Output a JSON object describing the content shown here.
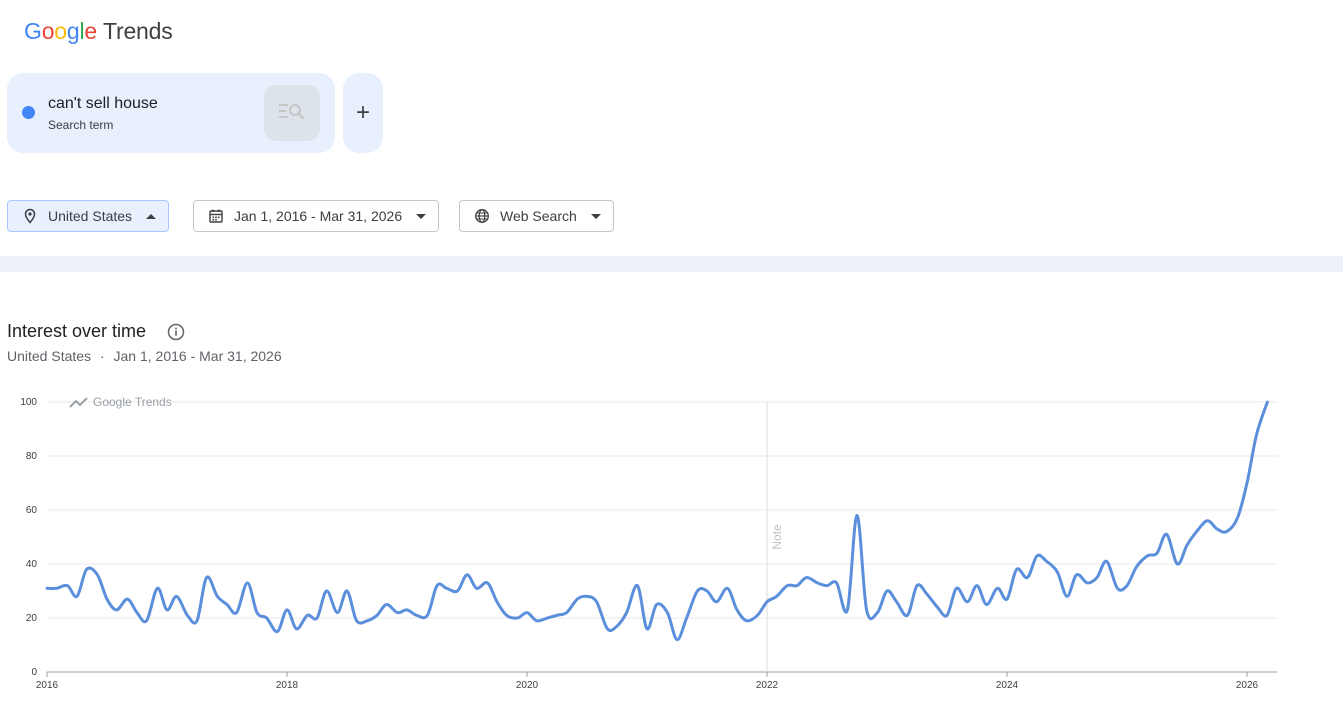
{
  "header": {
    "logo_google": "Google",
    "logo_trends": "Trends"
  },
  "term": {
    "name": "can't sell house",
    "type": "Search term",
    "color": "#4285f4",
    "add_label": "+"
  },
  "filters": {
    "region": "United States",
    "date_range": "Jan 1, 2016 - Mar 31, 2026",
    "property": "Web Search"
  },
  "section": {
    "title": "Interest over time",
    "region": "United States",
    "separator": "·",
    "date_range": "Jan 1, 2016 - Mar 31, 2026"
  },
  "chart_data": {
    "type": "line",
    "watermark": "Google Trends",
    "annotation": {
      "label": "Note",
      "x": 2022.0
    },
    "xlim": [
      2016.0,
      2026.25
    ],
    "ylim": [
      0,
      100
    ],
    "x_ticks": [
      {
        "value": 2016,
        "label": "2016"
      },
      {
        "value": 2018,
        "label": "2018"
      },
      {
        "value": 2020,
        "label": "2020"
      },
      {
        "value": 2022,
        "label": "2022"
      },
      {
        "value": 2024,
        "label": "2024"
      },
      {
        "value": 2026,
        "label": "2026"
      }
    ],
    "y_ticks": [
      0,
      20,
      40,
      60,
      80,
      100
    ],
    "line_color": "#5b8fdc",
    "series": [
      {
        "x": [
          2016.0,
          2016.08,
          2016.17,
          2016.25,
          2016.33,
          2016.42,
          2016.5,
          2016.58,
          2016.67,
          2016.75,
          2016.83,
          2016.92,
          2017.0,
          2017.08,
          2017.17,
          2017.25,
          2017.33,
          2017.42,
          2017.5,
          2017.58,
          2017.67,
          2017.75,
          2017.83,
          2017.92,
          2018.0,
          2018.08,
          2018.17,
          2018.25,
          2018.33,
          2018.42,
          2018.5,
          2018.58,
          2018.67,
          2018.75,
          2018.83,
          2018.92,
          2019.0,
          2019.08,
          2019.17,
          2019.25,
          2019.33,
          2019.42,
          2019.5,
          2019.58,
          2019.67,
          2019.75,
          2019.83,
          2019.92,
          2020.0,
          2020.08,
          2020.17,
          2020.25,
          2020.33,
          2020.42,
          2020.5,
          2020.58,
          2020.67,
          2020.75,
          2020.83,
          2020.92,
          2021.0,
          2021.08,
          2021.17,
          2021.25,
          2021.33,
          2021.42,
          2021.5,
          2021.58,
          2021.67,
          2021.75,
          2021.83,
          2021.92,
          2022.0,
          2022.08,
          2022.17,
          2022.25,
          2022.33,
          2022.42,
          2022.5,
          2022.58,
          2022.67,
          2022.75,
          2022.83,
          2022.92,
          2023.0,
          2023.08,
          2023.17,
          2023.25,
          2023.33,
          2023.42,
          2023.5,
          2023.58,
          2023.67,
          2023.75,
          2023.83,
          2023.92,
          2024.0,
          2024.08,
          2024.17,
          2024.25,
          2024.33,
          2024.42,
          2024.5,
          2024.58,
          2024.67,
          2024.75,
          2024.83,
          2024.92,
          2025.0,
          2025.08,
          2025.17,
          2025.25,
          2025.33,
          2025.42,
          2025.5,
          2025.58,
          2025.67,
          2025.75,
          2025.83,
          2025.92,
          2026.0,
          2026.08,
          2026.17
        ],
        "values": [
          31,
          31,
          32,
          28,
          38,
          36,
          27,
          23,
          27,
          22,
          19,
          31,
          23,
          28,
          21,
          19,
          35,
          28,
          25,
          22,
          33,
          22,
          20,
          15,
          23,
          16,
          21,
          20,
          30,
          22,
          30,
          19,
          19,
          21,
          25,
          22,
          23,
          21,
          21,
          32,
          31,
          30,
          36,
          31,
          33,
          26,
          21,
          20,
          22,
          19,
          20,
          21,
          22,
          27,
          28,
          26,
          16,
          17,
          22,
          32,
          16,
          25,
          22,
          12,
          20,
          30,
          30,
          26,
          31,
          23,
          19,
          21,
          26,
          28,
          32,
          32,
          35,
          33,
          32,
          33,
          23,
          58,
          23,
          22,
          30,
          26,
          21,
          32,
          29,
          24,
          21,
          31,
          26,
          32,
          25,
          31,
          27,
          38,
          35,
          43,
          41,
          37,
          28,
          36,
          33,
          35,
          41,
          31,
          32,
          39,
          43,
          44,
          51,
          40,
          47,
          52,
          56,
          53,
          52,
          57,
          70,
          88,
          100
        ]
      }
    ]
  }
}
